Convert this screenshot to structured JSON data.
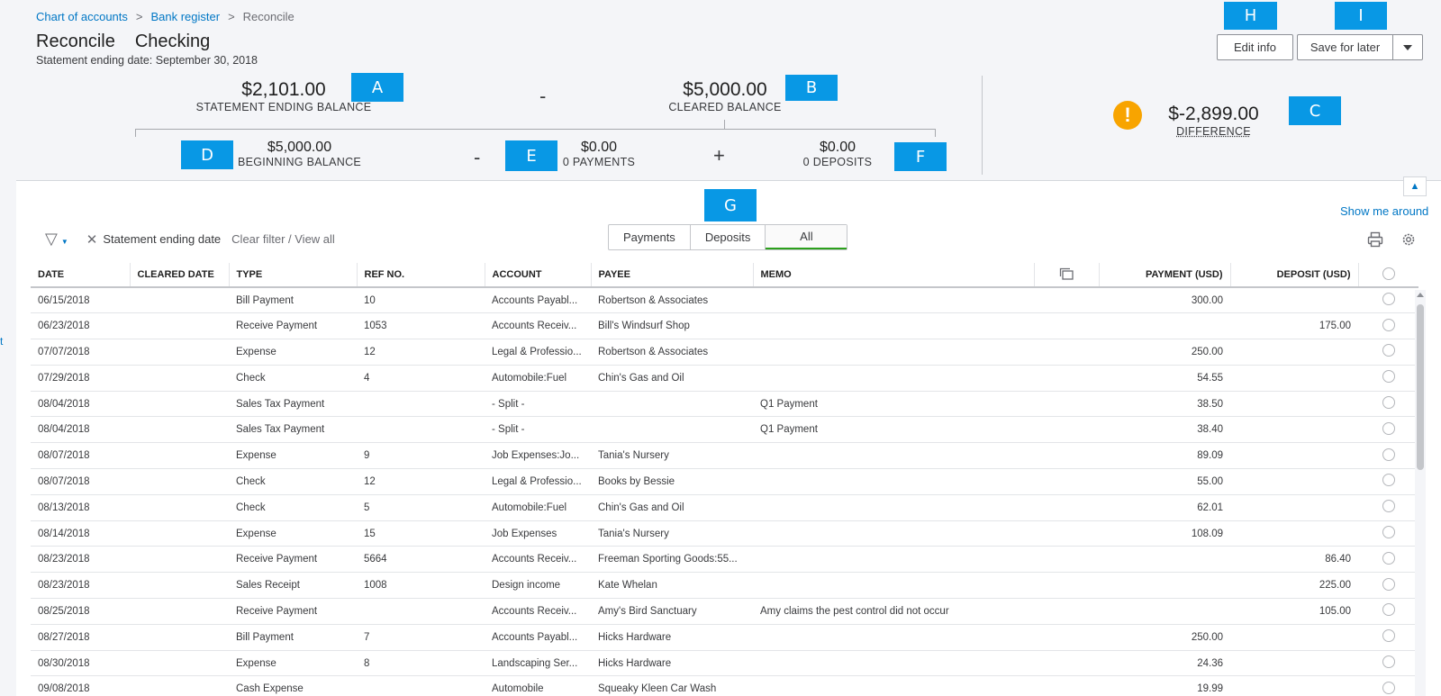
{
  "breadcrumb": {
    "item1": "Chart of accounts",
    "item2": "Bank register",
    "item3": "Reconcile",
    "sep": ">"
  },
  "header": {
    "title": "Reconcile",
    "account": "Checking",
    "subtitle": "Statement ending date: September 30, 2018"
  },
  "buttons": {
    "edit_info": "Edit info",
    "save_later": "Save for later"
  },
  "callouts": {
    "a": "A",
    "b": "B",
    "c": "C",
    "d": "D",
    "e": "E",
    "f": "F",
    "g": "G",
    "h": "H",
    "i": "I"
  },
  "summary": {
    "statement_balance": "$2,101.00",
    "statement_label": "STATEMENT ENDING BALANCE",
    "cleared_balance": "$5,000.00",
    "cleared_label": "CLEARED BALANCE",
    "beginning_balance": "$5,000.00",
    "beginning_label": "BEGINNING BALANCE",
    "payments": "$0.00",
    "payments_label": "0 PAYMENTS",
    "deposits": "$0.00",
    "deposits_label": "0 DEPOSITS",
    "difference": "$-2,899.00",
    "difference_label": "DIFFERENCE",
    "op_minus": "-",
    "op_plus": "+",
    "warn": "!"
  },
  "links": {
    "show_me_around": "Show me around",
    "left_edge": "t"
  },
  "filter": {
    "chip": "Statement ending date",
    "clear": "Clear filter / View all"
  },
  "tabs": {
    "payments": "Payments",
    "deposits": "Deposits",
    "all": "All",
    "selected": "All"
  },
  "table": {
    "headers": {
      "date": "DATE",
      "cleared_date": "CLEARED DATE",
      "type": "TYPE",
      "ref": "REF NO.",
      "account": "ACCOUNT",
      "payee": "PAYEE",
      "memo": "MEMO",
      "payment": "PAYMENT (USD)",
      "deposit": "DEPOSIT (USD)"
    },
    "rows": [
      {
        "date": "06/15/2018",
        "cleared": "",
        "type": "Bill Payment",
        "ref": "10",
        "account": "Accounts Payabl...",
        "payee": "Robertson & Associates",
        "memo": "",
        "payment": "300.00",
        "deposit": ""
      },
      {
        "date": "06/23/2018",
        "cleared": "",
        "type": "Receive Payment",
        "ref": "1053",
        "account": "Accounts Receiv...",
        "payee": "Bill's Windsurf Shop",
        "memo": "",
        "payment": "",
        "deposit": "175.00"
      },
      {
        "date": "07/07/2018",
        "cleared": "",
        "type": "Expense",
        "ref": "12",
        "account": "Legal & Professio...",
        "payee": "Robertson & Associates",
        "memo": "",
        "payment": "250.00",
        "deposit": ""
      },
      {
        "date": "07/29/2018",
        "cleared": "",
        "type": "Check",
        "ref": "4",
        "account": "Automobile:Fuel",
        "payee": "Chin's Gas and Oil",
        "memo": "",
        "payment": "54.55",
        "deposit": ""
      },
      {
        "date": "08/04/2018",
        "cleared": "",
        "type": "Sales Tax Payment",
        "ref": "",
        "account": "- Split -",
        "payee": "",
        "memo": "Q1 Payment",
        "payment": "38.50",
        "deposit": ""
      },
      {
        "date": "08/04/2018",
        "cleared": "",
        "type": "Sales Tax Payment",
        "ref": "",
        "account": "- Split -",
        "payee": "",
        "memo": "Q1 Payment",
        "payment": "38.40",
        "deposit": ""
      },
      {
        "date": "08/07/2018",
        "cleared": "",
        "type": "Expense",
        "ref": "9",
        "account": "Job Expenses:Jo...",
        "payee": "Tania's Nursery",
        "memo": "",
        "payment": "89.09",
        "deposit": ""
      },
      {
        "date": "08/07/2018",
        "cleared": "",
        "type": "Check",
        "ref": "12",
        "account": "Legal & Professio...",
        "payee": "Books by Bessie",
        "memo": "",
        "payment": "55.00",
        "deposit": ""
      },
      {
        "date": "08/13/2018",
        "cleared": "",
        "type": "Check",
        "ref": "5",
        "account": "Automobile:Fuel",
        "payee": "Chin's Gas and Oil",
        "memo": "",
        "payment": "62.01",
        "deposit": ""
      },
      {
        "date": "08/14/2018",
        "cleared": "",
        "type": "Expense",
        "ref": "15",
        "account": "Job Expenses",
        "payee": "Tania's Nursery",
        "memo": "",
        "payment": "108.09",
        "deposit": ""
      },
      {
        "date": "08/23/2018",
        "cleared": "",
        "type": "Receive Payment",
        "ref": "5664",
        "account": "Accounts Receiv...",
        "payee": "Freeman Sporting Goods:55...",
        "memo": "",
        "payment": "",
        "deposit": "86.40"
      },
      {
        "date": "08/23/2018",
        "cleared": "",
        "type": "Sales Receipt",
        "ref": "1008",
        "account": "Design income",
        "payee": "Kate Whelan",
        "memo": "",
        "payment": "",
        "deposit": "225.00"
      },
      {
        "date": "08/25/2018",
        "cleared": "",
        "type": "Receive Payment",
        "ref": "",
        "account": "Accounts Receiv...",
        "payee": "Amy's Bird Sanctuary",
        "memo": "Amy claims the pest control did not occur",
        "payment": "",
        "deposit": "105.00"
      },
      {
        "date": "08/27/2018",
        "cleared": "",
        "type": "Bill Payment",
        "ref": "7",
        "account": "Accounts Payabl...",
        "payee": "Hicks Hardware",
        "memo": "",
        "payment": "250.00",
        "deposit": ""
      },
      {
        "date": "08/30/2018",
        "cleared": "",
        "type": "Expense",
        "ref": "8",
        "account": "Landscaping Ser...",
        "payee": "Hicks Hardware",
        "memo": "",
        "payment": "24.36",
        "deposit": ""
      },
      {
        "date": "09/08/2018",
        "cleared": "",
        "type": "Cash Expense",
        "ref": "",
        "account": "Automobile",
        "payee": "Squeaky Kleen Car Wash",
        "memo": "",
        "payment": "19.99",
        "deposit": ""
      }
    ]
  },
  "colors": {
    "accent": "#0077c5",
    "callout": "#0898e5",
    "warning": "#f8a400",
    "selected_tab": "#2ca01c"
  }
}
